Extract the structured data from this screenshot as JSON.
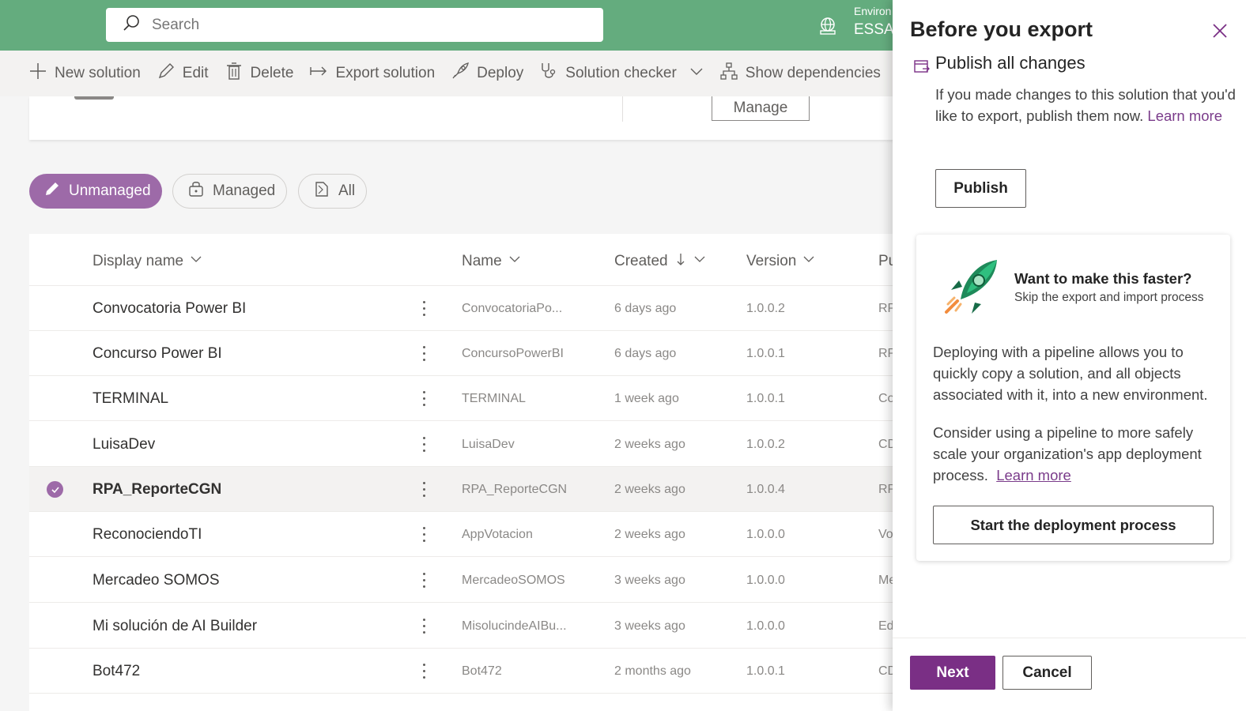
{
  "header": {
    "search_placeholder": "Search",
    "environment_label": "Environ",
    "environment_name": "ESSA_"
  },
  "commands": {
    "new_solution": "New solution",
    "edit": "Edit",
    "delete": "Delete",
    "export_solution": "Export solution",
    "deploy": "Deploy",
    "solution_checker": "Solution checker",
    "show_dependencies": "Show dependencies"
  },
  "top_card": {
    "manage_label": "Manage"
  },
  "filters": {
    "unmanaged": "Unmanaged",
    "managed": "Managed",
    "all": "All"
  },
  "table": {
    "columns": {
      "display_name": "Display name",
      "name": "Name",
      "created": "Created",
      "version": "Version",
      "publisher": "Pu"
    },
    "rows": [
      {
        "display": "Convocatoria Power BI",
        "name": "ConvocatoriaPo...",
        "created": "6 days ago",
        "version": "1.0.0.2",
        "publisher": "RP",
        "selected": false
      },
      {
        "display": "Concurso Power BI",
        "name": "ConcursoPowerBI",
        "created": "6 days ago",
        "version": "1.0.0.1",
        "publisher": "RP",
        "selected": false
      },
      {
        "display": "TERMINAL",
        "name": "TERMINAL",
        "created": "1 week ago",
        "version": "1.0.0.1",
        "publisher": "Co",
        "selected": false
      },
      {
        "display": "LuisaDev",
        "name": "LuisaDev",
        "created": "2 weeks ago",
        "version": "1.0.0.2",
        "publisher": "CD",
        "selected": false
      },
      {
        "display": "RPA_ReporteCGN",
        "name": "RPA_ReporteCGN",
        "created": "2 weeks ago",
        "version": "1.0.0.4",
        "publisher": "RP",
        "selected": true
      },
      {
        "display": "ReconociendoTI",
        "name": "AppVotacion",
        "created": "2 weeks ago",
        "version": "1.0.0.0",
        "publisher": "Vo",
        "selected": false
      },
      {
        "display": "Mercadeo SOMOS",
        "name": "MercadeoSOMOS",
        "created": "3 weeks ago",
        "version": "1.0.0.0",
        "publisher": "Me",
        "selected": false
      },
      {
        "display": "Mi solución de AI Builder",
        "name": "MisolucindeAIBu...",
        "created": "3 weeks ago",
        "version": "1.0.0.0",
        "publisher": "Ed",
        "selected": false
      },
      {
        "display": "Bot472",
        "name": "Bot472",
        "created": "2 months ago",
        "version": "1.0.0.1",
        "publisher": "CD",
        "selected": false
      }
    ]
  },
  "panel": {
    "title": "Before you export",
    "section_title": "Publish all changes",
    "section_text": "If you made changes to this solution that you'd like to export, publish them now.",
    "section_link": "Learn more",
    "publish_label": "Publish",
    "card": {
      "heading": "Want to make this faster?",
      "subheading": "Skip the export and import process",
      "para1": "Deploying with a pipeline allows you to quickly copy a solution, and all objects associated with it, into a new environment.",
      "para2": "Consider using a pipeline to more safely scale your organization's app deployment process.",
      "para2_link": "Learn more",
      "deploy_button": "Start the deployment process"
    },
    "next_label": "Next",
    "cancel_label": "Cancel"
  },
  "colors": {
    "header_green": "#64ac7e",
    "accent_purple": "#7a2f85",
    "pill_purple": "#9d6aa8"
  }
}
